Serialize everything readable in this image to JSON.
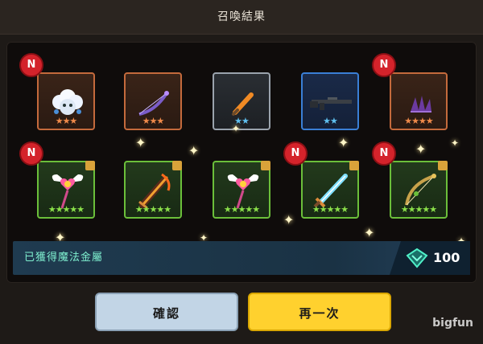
{
  "window": {
    "title": "召喚結果"
  },
  "results": {
    "row1": [
      {
        "item": "white-flower-pet",
        "rarity": "orange",
        "stars": "★★★",
        "new": true
      },
      {
        "item": "purple-bow",
        "rarity": "orange",
        "stars": "★★★",
        "new": false
      },
      {
        "item": "orange-dagger",
        "rarity": "gray",
        "stars": "★★",
        "new": false
      },
      {
        "item": "rifle",
        "rarity": "blue",
        "stars": "★★",
        "new": false
      },
      {
        "item": "purple-claw",
        "rarity": "orange",
        "stars": "★★★★",
        "new": true
      }
    ],
    "row2": [
      {
        "item": "winged-heart-staff",
        "rarity": "green",
        "stars": "★★★★★",
        "new": true
      },
      {
        "item": "flame-greatsword",
        "rarity": "green",
        "stars": "★★★★★",
        "new": false
      },
      {
        "item": "winged-heart-staff",
        "rarity": "green",
        "stars": "★★★★★",
        "new": false
      },
      {
        "item": "ice-sword",
        "rarity": "green",
        "stars": "★★★★★",
        "new": true
      },
      {
        "item": "golden-bow",
        "rarity": "green",
        "stars": "★★★★★",
        "new": true
      }
    ],
    "new_badge_label": "N"
  },
  "banner": {
    "text": "已獲得魔法金屬",
    "icon": "magic-metal-gem-icon",
    "count": "100"
  },
  "buttons": {
    "confirm": "確認",
    "again": "再一次"
  },
  "watermark": "bigfun",
  "colors": {
    "orange": "#c46a3c",
    "gray": "#9aa3ad",
    "blue": "#3a7fd6",
    "green": "#6bbf3a",
    "again_button": "#ffd12e",
    "confirm_button": "#c2d5e6",
    "banner_text": "#7ff0d0"
  }
}
